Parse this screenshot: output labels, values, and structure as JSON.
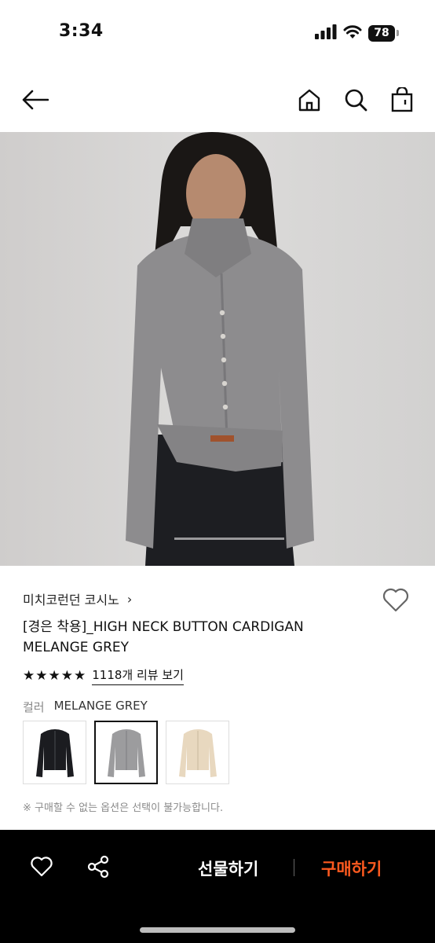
{
  "status": {
    "time": "3:34",
    "battery": "78"
  },
  "nav": {
    "back_icon": "arrow-left-icon",
    "home_icon": "home-icon",
    "search_icon": "search-icon",
    "bag_icon": "shopping-bag-icon"
  },
  "product": {
    "brand": "미치코런던 코시노",
    "brand_chevron": "›",
    "title": "[경은 착용]_HIGH NECK BUTTON CARDIGAN MELANGE GREY",
    "rating": 5,
    "review_link": "1118개 리뷰 보기",
    "color_label": "컬러",
    "color_value": "MELANGE GREY",
    "swatches": [
      {
        "name": "black",
        "hex": "#1b1c20",
        "selected": false
      },
      {
        "name": "melange grey",
        "hex": "#9c9c9e",
        "selected": true
      },
      {
        "name": "beige",
        "hex": "#e8d8bf",
        "selected": false
      }
    ],
    "notice": "※ 구매할 수 없는 옵션은 선택이 불가능합니다."
  },
  "bottom_bar": {
    "gift_label": "선물하기",
    "buy_label": "구매하기",
    "buy_color": "#ff5a1f"
  }
}
